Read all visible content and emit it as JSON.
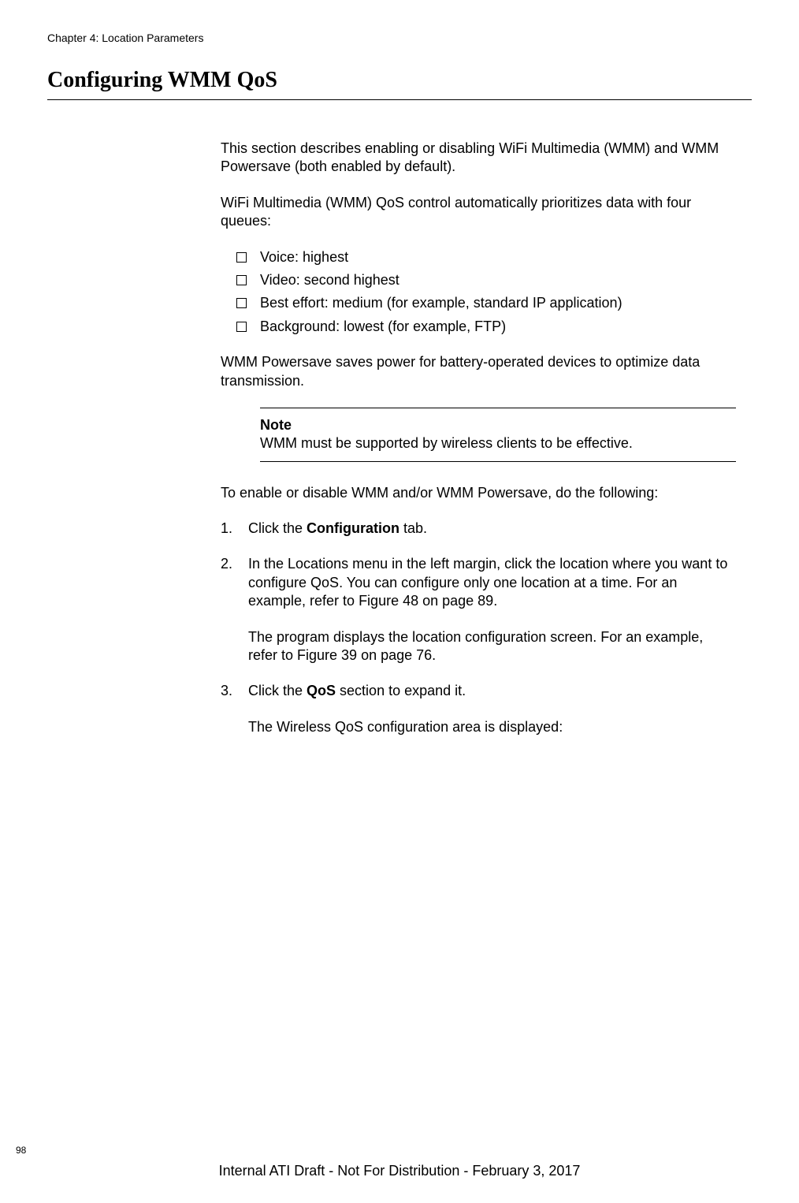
{
  "chapter": "Chapter 4: Location Parameters",
  "sectionTitle": "Configuring WMM QoS",
  "intro1": "This section describes enabling or disabling WiFi Multimedia (WMM) and WMM Powersave (both enabled by default).",
  "intro2": "WiFi Multimedia (WMM) QoS control automatically prioritizes data with four queues:",
  "bullets": {
    "b1": "Voice: highest",
    "b2": "Video: second highest",
    "b3": "Best effort: medium (for example, standard IP application)",
    "b4": "Background: lowest (for example, FTP)"
  },
  "powersave": "WMM Powersave saves power for battery-operated devices to optimize data transmission.",
  "note": {
    "title": "Note",
    "text": "WMM must be supported by wireless clients to be effective."
  },
  "instructions": "To enable or disable WMM and/or WMM Powersave, do the following:",
  "steps": {
    "s1a": "Click the ",
    "s1b": "Configuration",
    "s1c": " tab.",
    "s2a": "In the Locations menu in the left margin, click the location where you want to configure QoS. You can configure only one location at a time. For an example, refer to Figure 48 on page 89.",
    "s2b": "The program displays the location configuration screen. For an example, refer to Figure 39 on page 76.",
    "s3a": "Click the ",
    "s3b": "QoS",
    "s3c": " section to expand it.",
    "s3d": "The Wireless QoS configuration area is displayed:"
  },
  "pageNumber": "98",
  "footer": "Internal ATI Draft - Not For Distribution - February 3, 2017"
}
